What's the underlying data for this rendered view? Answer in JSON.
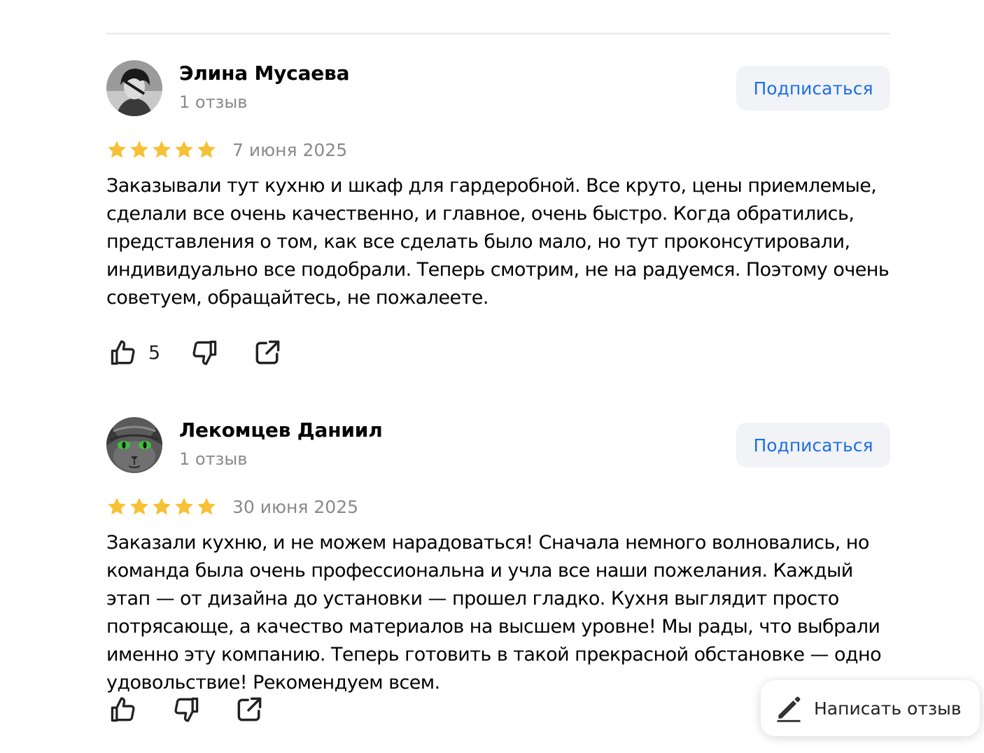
{
  "reviews": [
    {
      "author": "Элина Мусаева",
      "meta": "1 отзыв",
      "subscribe_label": "Подписаться",
      "rating": 5,
      "date": "7 июня 2025",
      "text": "Заказывали тут кухню и шкаф для гардеробной. Все круто, цены приемлемые, сделали все очень качественно, и главное, очень быстро. Когда обратились, представления о том, как все сделать было мало, но тут проконсутировали, индивидуально все подобрали. Теперь смотрим, не на радуемся. Поэтому очень советуем, обращайтесь, не пожалеете.",
      "likes": "5"
    },
    {
      "author": "Лекомцев Даниил",
      "meta": "1 отзыв",
      "subscribe_label": "Подписаться",
      "rating": 5,
      "date": "30 июня 2025",
      "text": "Заказали кухню, и не можем нарадоваться! Сначала немного волновались, но команда была очень профессиональна и учла все наши пожелания. Каждый этап — от дизайна до установки — прошел гладко. Кухня выглядит просто потрясающе, а качество материалов на высшем уровне! Мы рады, что выбрали именно эту компанию. Теперь готовить в такой прекрасной обстановке — одно удовольствие! Рекомендуем всем."
    }
  ],
  "write_review": {
    "label": "Написать отзыв",
    "icon": "pencil-icon"
  },
  "icons": {
    "like": "thumbs-up-icon",
    "dislike": "thumbs-down-icon",
    "share": "share-icon",
    "star": "star-icon"
  },
  "colors": {
    "star": "#f6c136",
    "link": "#1e6fe6",
    "button_bg": "#f1f3f7",
    "muted_text": "#8a8a8a"
  }
}
